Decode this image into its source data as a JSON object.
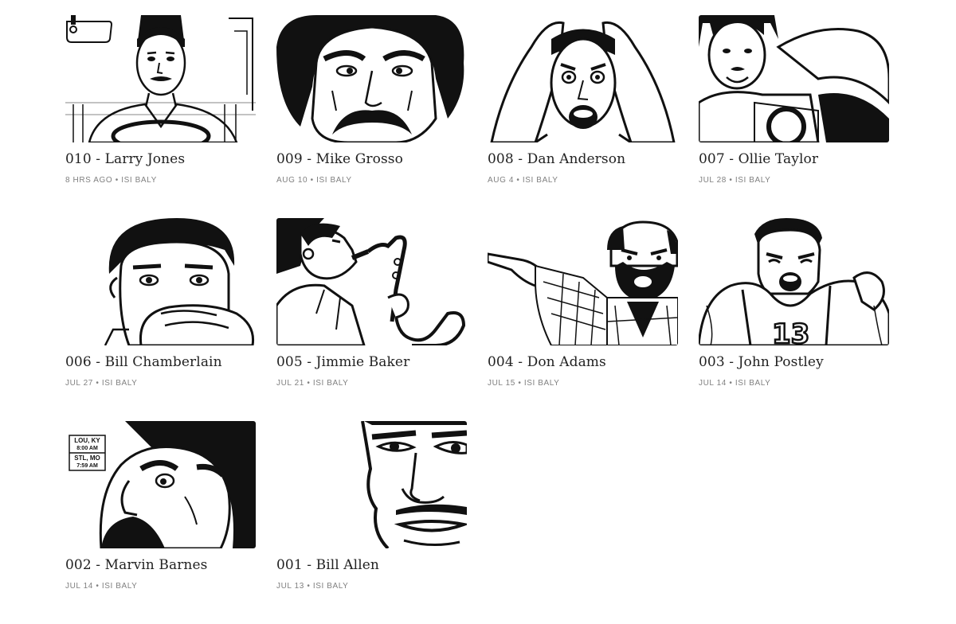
{
  "posts": [
    {
      "title": "010 - Larry Jones",
      "date": "8 HRS AGO",
      "author": "ISI BALY"
    },
    {
      "title": "009 - Mike Grosso",
      "date": "AUG 10",
      "author": "ISI BALY"
    },
    {
      "title": "008 - Dan Anderson",
      "date": "AUG 4",
      "author": "ISI BALY"
    },
    {
      "title": "007 - Ollie Taylor",
      "date": "JUL 28",
      "author": "ISI BALY"
    },
    {
      "title": "006 - Bill Chamberlain",
      "date": "JUL 27",
      "author": "ISI BALY"
    },
    {
      "title": "005 - Jimmie Baker",
      "date": "JUL 21",
      "author": "ISI BALY"
    },
    {
      "title": "004 - Don Adams",
      "date": "JUL 15",
      "author": "ISI BALY"
    },
    {
      "title": "003 - John Postley",
      "date": "JUL 14",
      "author": "ISI BALY"
    },
    {
      "title": "002 - Marvin Barnes",
      "date": "JUL 14",
      "author": "ISI BALY"
    },
    {
      "title": "001 - Bill Allen",
      "date": "JUL 13",
      "author": "ISI BALY"
    }
  ],
  "meta_separator": "•",
  "thumb_002_sign": {
    "line1": "LOU, KY",
    "line2": "8:00 AM",
    "line3": "STL, MO",
    "line4": "7:59 AM"
  },
  "thumb_003_jersey": "13"
}
